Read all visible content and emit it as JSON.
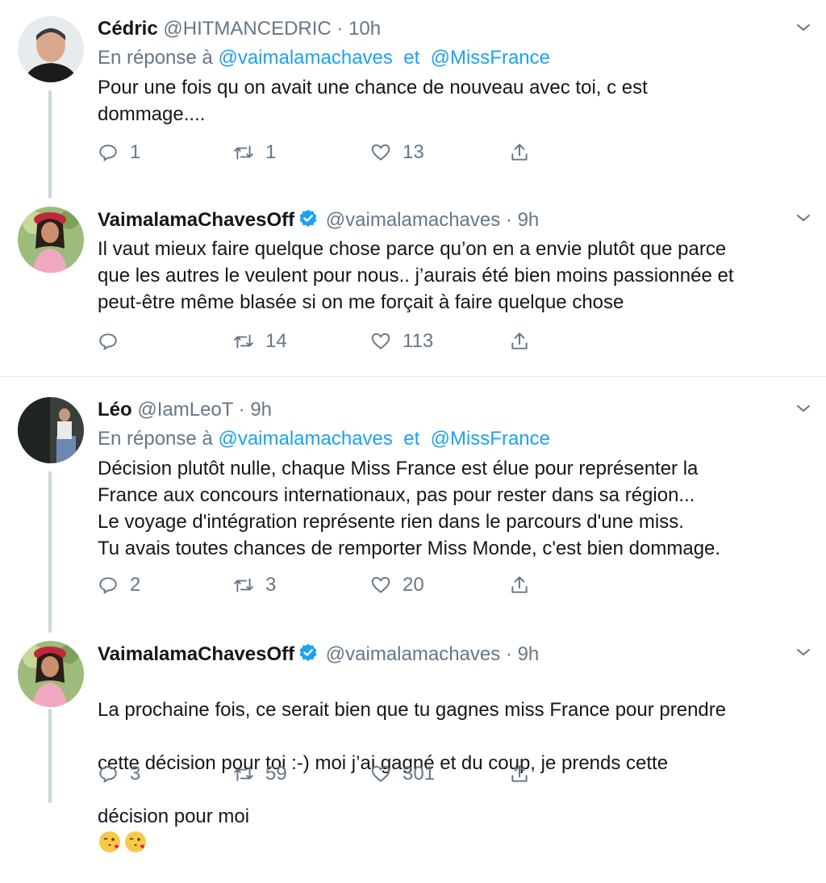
{
  "icons": {
    "reply": "reply-icon",
    "retweet": "retweet-icon",
    "like": "heart-icon",
    "share": "share-icon",
    "menu": "chevron-down-icon",
    "verified": "verified-badge-icon"
  },
  "colors": {
    "link": "#1da1f2",
    "muted": "#657786",
    "text": "#14171a",
    "verified": "#1da1f2",
    "thread_line": "#ccd6dd"
  },
  "tweets": [
    {
      "name": "Cédric",
      "handle": "@HITMANCEDRIC",
      "time": "· 10h",
      "reply_prefix": "En réponse à",
      "reply_mention_1": "@vaimalamachaves",
      "reply_and": "et",
      "reply_mention_2": "@MissFrance",
      "text": "Pour une fois qu on avait une chance de nouveau avec toi, c est\ndommage....",
      "replies": "1",
      "retweets": "1",
      "likes": "13"
    },
    {
      "name": "VaimalamaChavesOff",
      "handle": "@vaimalamachaves",
      "time": "· 9h",
      "text": "Il vaut mieux faire quelque chose parce qu’on en a envie plutôt que parce\nque les autres le veulent pour nous.. j’aurais été bien moins passionnée et\npeut-être même blasée si on me forçait à faire quelque chose",
      "replies": "",
      "retweets": "14",
      "likes": "113"
    },
    {
      "name": "Léo",
      "handle": "@IamLeoT",
      "time": "· 9h",
      "reply_prefix": "En réponse à",
      "reply_mention_1": "@vaimalamachaves",
      "reply_and": "et",
      "reply_mention_2": "@MissFrance",
      "text": "Décision plutôt nulle, chaque Miss France est élue pour représenter la\nFrance aux concours internationaux, pas pour rester dans sa région...\nLe voyage d'intégration représente rien dans le parcours d'une miss.\nTu avais toutes chances de remporter Miss Monde, c'est bien dommage.",
      "replies": "2",
      "retweets": "3",
      "likes": "20"
    },
    {
      "name": "VaimalamaChavesOff",
      "handle": "@vaimalamachaves",
      "time": "· 9h",
      "text_line_1": "La prochaine fois, ce serait bien que tu gagnes miss France pour prendre",
      "text_line_2": "cette décision pour toi :-) moi j’ai gagné et du coup, je prends cette",
      "text_line_3": "décision pour moi",
      "emoji": "face-blowing-kiss-emoji",
      "replies": "3",
      "retweets": "59",
      "likes": "301"
    }
  ]
}
